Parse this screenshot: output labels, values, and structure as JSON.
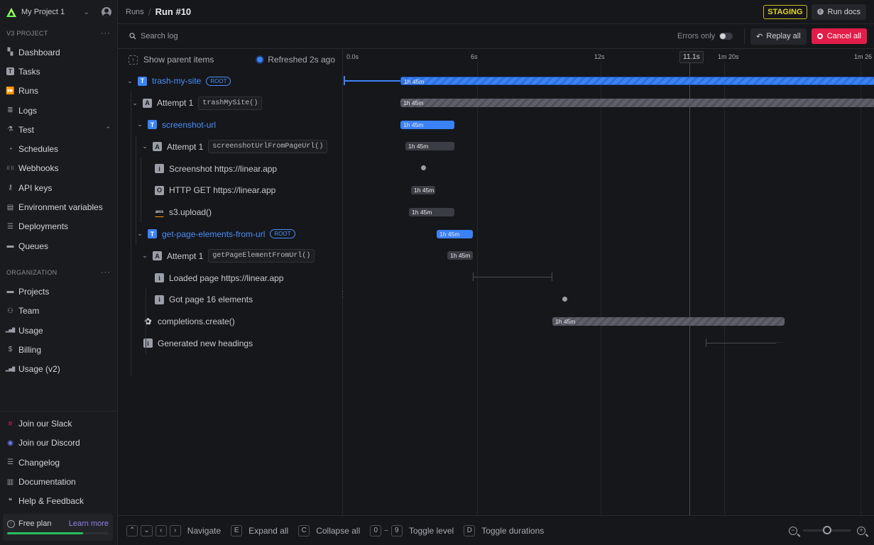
{
  "project": {
    "name": "My Project 1"
  },
  "sidebar": {
    "v3_title": "V3 PROJECT",
    "v3_items": [
      {
        "label": "Dashboard",
        "icon": "dashboard-icon"
      },
      {
        "label": "Tasks",
        "icon": "tasks-icon"
      },
      {
        "label": "Runs",
        "icon": "runs-icon"
      },
      {
        "label": "Logs",
        "icon": "logs-icon"
      },
      {
        "label": "Test",
        "icon": "beaker-icon"
      },
      {
        "label": "Schedules",
        "icon": "clock-icon"
      },
      {
        "label": "Webhooks",
        "icon": "webhook-icon"
      },
      {
        "label": "API keys",
        "icon": "key-icon"
      },
      {
        "label": "Environment variables",
        "icon": "id-card-icon"
      },
      {
        "label": "Deployments",
        "icon": "server-stack-icon"
      },
      {
        "label": "Queues",
        "icon": "queue-icon"
      }
    ],
    "org_title": "ORGANIZATION",
    "org_items": [
      {
        "label": "Projects",
        "icon": "folder-icon"
      },
      {
        "label": "Team",
        "icon": "team-icon"
      },
      {
        "label": "Usage",
        "icon": "bar-chart-icon"
      },
      {
        "label": "Billing",
        "icon": "dollar-icon"
      },
      {
        "label": "Usage (v2)",
        "icon": "bar-chart-icon"
      }
    ],
    "bottom_items": [
      {
        "label": "Join our Slack",
        "icon": "slack-icon"
      },
      {
        "label": "Join our Discord",
        "icon": "discord-icon"
      },
      {
        "label": "Changelog",
        "icon": "list-icon"
      },
      {
        "label": "Documentation",
        "icon": "book-icon"
      },
      {
        "label": "Help & Feedback",
        "icon": "chat-icon"
      }
    ],
    "plan": {
      "label": "Free plan",
      "link": "Learn more",
      "usage_fraction": 0.75
    }
  },
  "header": {
    "breadcrumb": "Runs",
    "title": "Run #10",
    "env_badge": "STAGING",
    "run_docs": "Run docs"
  },
  "toolbar": {
    "search_placeholder": "Search log",
    "errors_only": "Errors only",
    "errors_only_on": false,
    "replay": "Replay all",
    "cancel": "Cancel all"
  },
  "tree": {
    "show_parent": "Show parent items",
    "refreshed": "Refreshed 2s ago",
    "rows": [
      {
        "label": "trash-my-site",
        "badge": "T",
        "root": "ROOT"
      },
      {
        "label": "Attempt 1",
        "badge": "A",
        "code": "trashMySite()"
      },
      {
        "label": "screenshot-url",
        "badge": "T"
      },
      {
        "label": "Attempt 1",
        "badge": "A",
        "code": "screenshotUrlFromPageUrl()"
      },
      {
        "label": "Screenshot https://linear.app",
        "badge": "i"
      },
      {
        "label": "HTTP GET https://linear.app",
        "badge": "O"
      },
      {
        "label": "s3.upload()",
        "badge": "aws"
      },
      {
        "label": "get-page-elements-from-url",
        "badge": "T",
        "root": "ROOT"
      },
      {
        "label": "Attempt 1",
        "badge": "A",
        "code": "getPageElementFromUrl()"
      },
      {
        "label": "Loaded page https://linear.app",
        "badge": "i"
      },
      {
        "label": "Got page 16 elements",
        "badge": "i"
      },
      {
        "label": "completions.create()",
        "badge": "openai"
      },
      {
        "label": "Generated new headings",
        "badge": "i"
      }
    ]
  },
  "timeline": {
    "ticks": [
      "0.0s",
      "6s",
      "12s",
      "1m 20s",
      "1m 26"
    ],
    "cursor": "11.1s",
    "spans": [
      {
        "duration": "1h 45m",
        "style": "blue-stripe"
      },
      {
        "duration": "1h 45m",
        "style": "grey-stripe"
      },
      {
        "duration": "1h 45m",
        "style": "blue-solid"
      },
      {
        "duration": "1h 45m",
        "style": "grey-solid"
      },
      {
        "duration": "",
        "style": "point"
      },
      {
        "duration": "1h 45m",
        "style": "grey-solid"
      },
      {
        "duration": "1h 45m",
        "style": "grey-solid"
      },
      {
        "duration": "1h 45m",
        "style": "blue-solid"
      },
      {
        "duration": "1h 45m",
        "style": "grey-solid"
      },
      {
        "duration": "",
        "style": "interval"
      },
      {
        "duration": "",
        "style": "point"
      },
      {
        "duration": "1h 45m",
        "style": "grey-stripe"
      },
      {
        "duration": "",
        "style": "interval-open"
      }
    ]
  },
  "footer": {
    "navigate": "Navigate",
    "expand_key": "E",
    "expand": "Expand all",
    "collapse_key": "C",
    "collapse": "Collapse all",
    "level_from": "0",
    "level_to": "9",
    "level": "Toggle level",
    "durations_key": "D",
    "durations": "Toggle durations",
    "zoom_level": 0.5
  }
}
